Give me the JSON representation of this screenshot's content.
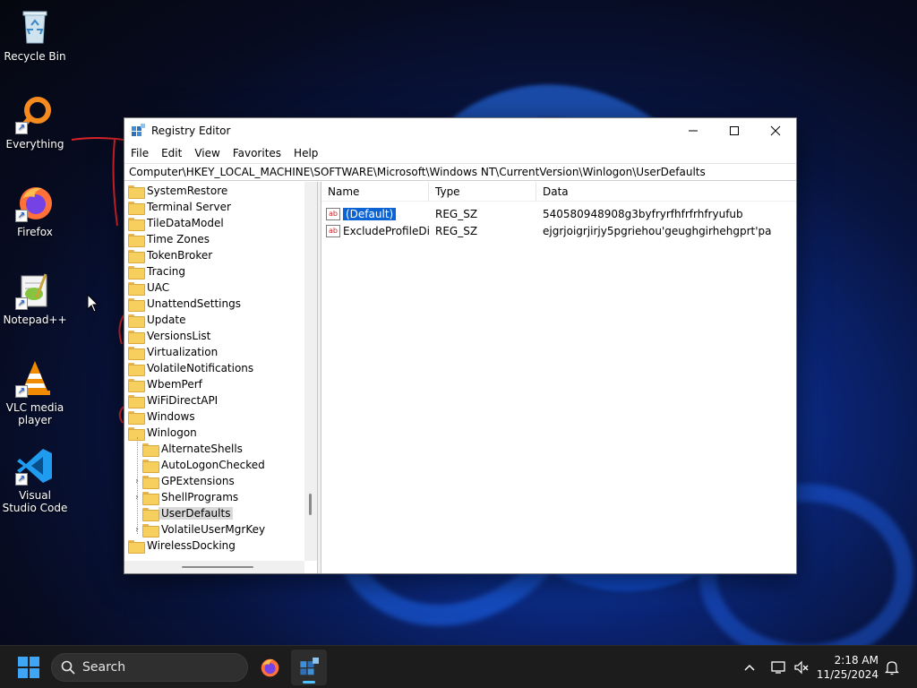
{
  "desktop": {
    "icons": [
      {
        "label": "Recycle Bin",
        "icon": "recycle-bin-icon"
      },
      {
        "label": "Everything",
        "icon": "everything-search-icon"
      },
      {
        "label": "Firefox",
        "icon": "firefox-icon"
      },
      {
        "label": "Notepad++",
        "icon": "notepadpp-icon"
      },
      {
        "label": "VLC media player",
        "icon": "vlc-icon"
      },
      {
        "label": "Visual Studio Code",
        "icon": "vscode-icon"
      }
    ]
  },
  "window": {
    "title": "Registry Editor",
    "menu": [
      "File",
      "Edit",
      "View",
      "Favorites",
      "Help"
    ],
    "address": "Computer\\HKEY_LOCAL_MACHINE\\SOFTWARE\\Microsoft\\Windows NT\\CurrentVersion\\Winlogon\\UserDefaults",
    "tree": {
      "root_items": [
        "SystemRestore",
        "Terminal Server",
        "TileDataModel",
        "Time Zones",
        "TokenBroker",
        "Tracing",
        "UAC",
        "UnattendSettings",
        "Update",
        "VersionsList",
        "Virtualization",
        "VolatileNotifications",
        "WbemPerf",
        "WiFiDirectAPI",
        "Windows",
        "Winlogon"
      ],
      "winlogon_children": [
        "AlternateShells",
        "AutoLogonChecked",
        "GPExtensions",
        "ShellPrograms",
        "UserDefaults",
        "VolatileUserMgrKey"
      ],
      "after_items": [
        "WirelessDocking"
      ],
      "selected": "UserDefaults"
    },
    "columns": [
      "Name",
      "Type",
      "Data"
    ],
    "values": [
      {
        "name": "(Default)",
        "type": "REG_SZ",
        "data": "540580948908g3byfryrfhfrfrhfryufub"
      },
      {
        "name": "ExcludeProfileDirs",
        "type": "REG_SZ",
        "data": "ejgrjoigrjirjy5pgriehou'geughgirhehgprt'pa"
      }
    ]
  },
  "taskbar": {
    "search_label": "Search",
    "time": "2:18 AM",
    "date": "11/25/2024"
  }
}
